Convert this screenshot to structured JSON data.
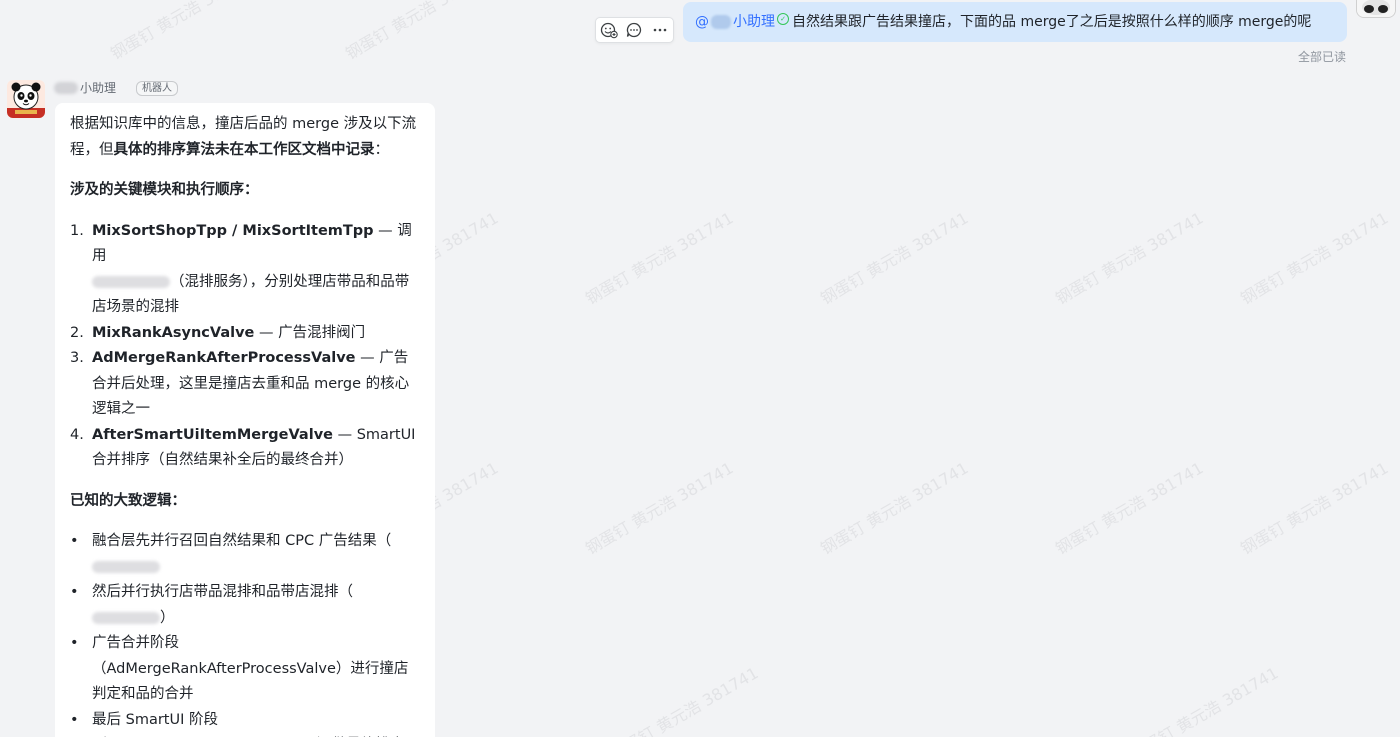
{
  "watermark": {
    "text": "钢蛋钉 黄元浩 381741"
  },
  "outgoing": {
    "mention_prefix": "@",
    "mention_name": "小助理",
    "text": "自然结果跟广告结果撞店，下面的品 merge了之后是按照什么样的顺序 merge的呢",
    "read_status": "全部已读",
    "toolbar": {
      "emoji_icon": "emoji-reaction-icon",
      "reply_icon": "reply-icon",
      "more_icon": "more-icon"
    }
  },
  "bot": {
    "name": "小助理",
    "tag": "机器人",
    "intro_plain": "根据知识库中的信息，撞店后品的 merge 涉及以下流程，但",
    "intro_bold": "具体的排序算法未在本工作区文档中记录",
    "intro_end": "：",
    "modules_heading": "涉及的关键模块和执行顺序：",
    "modules": [
      {
        "num": "1.",
        "name": "MixSortShopTpp / MixSortItemTpp",
        "desc_pre": " — 调用",
        "desc_post": "（混排服务），分别处理店带品和品带店场景的混排"
      },
      {
        "num": "2.",
        "name": "MixRankAsyncValve",
        "desc": " — 广告混排阀门"
      },
      {
        "num": "3.",
        "name": "AdMergeRankAfterProcessValve",
        "desc": " — 广告合并后处理，这里是撞店去重和品 merge 的核心逻辑之一"
      },
      {
        "num": "4.",
        "name": "AfterSmartUiItemMergeValve",
        "desc": " — SmartUI 合并排序（自然结果补全后的最终合并）"
      }
    ],
    "logic_heading": "已知的大致逻辑：",
    "logic": [
      {
        "pre": "融合层先并行召回自然结果和 CPC 广告结果（",
        "post": ""
      },
      {
        "pre": "然后并行执行店带品混排和品带店混排（",
        "post": "）"
      },
      {
        "text": "广告合并阶段（AdMergeRankAfterProcessValve）进行撞店判定和品的合并"
      },
      {
        "text": "最后 SmartUI 阶段（AfterSmartUiItemMergeValve）做最终排序"
      }
    ]
  }
}
